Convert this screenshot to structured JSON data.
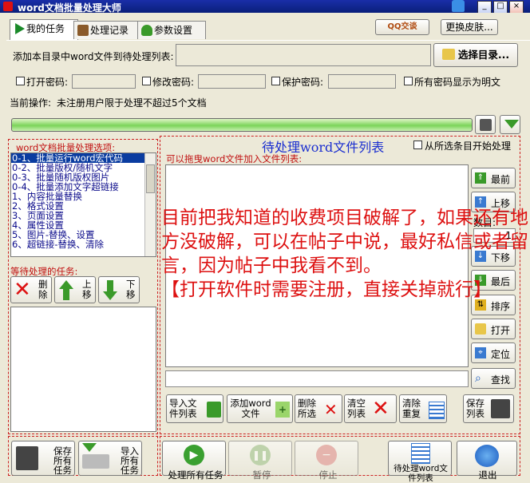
{
  "window": {
    "title": "word文档批量处理大师",
    "controls": [
      "_",
      "□",
      "×"
    ]
  },
  "tabs": [
    {
      "label": "我的任务"
    },
    {
      "label": "处理记录"
    },
    {
      "label": "参数设置"
    }
  ],
  "header": {
    "qq_label": "QQ交谈",
    "skin_button": "更换皮肤..."
  },
  "dir": {
    "label": "添加本目录中word文件到待处理列表:",
    "value": "",
    "select_button": "选择目录..."
  },
  "passwords": {
    "open_label": "打开密码:",
    "open_value": "",
    "modify_label": "修改密码:",
    "modify_value": "",
    "protect_label": "保护密码:",
    "protect_value": "",
    "show_plain_label": "所有密码显示为明文"
  },
  "status": {
    "label": "当前操作:",
    "text": "未注册用户限于处理不超过5个文档",
    "progress": 1.0
  },
  "options": {
    "title": "word文档批量处理选项:",
    "items": [
      "0-1、批量运行word宏代码",
      "0-2、批量版权/随机文字",
      "0-3、批量随机版权图片",
      "0-4、批量添加文字超链接",
      "1、内容批量替换",
      "2、格式设置",
      "3、页面设置",
      "4、属性设置",
      "5、图片-替换、设置",
      "6、超链接-替换、清除"
    ]
  },
  "tasks": {
    "title": "等待处理的任务:",
    "delete": "删除",
    "up": "上移",
    "down": "下移"
  },
  "filelist": {
    "title": "待处理word文件列表",
    "start_from_selected": "从所选条目开始处理",
    "drag_hint": "可以拖曳word文件加入文件列表:",
    "search_value": ""
  },
  "side_buttons": {
    "top": "最前",
    "up": "上移",
    "count_label": "数目:",
    "count_value": "1",
    "down": "下移",
    "bottom": "最后",
    "sort": "排序",
    "open": "打开",
    "locate": "定位",
    "find": "查找"
  },
  "bottom_buttons": {
    "import": "导入文件列表",
    "add": "添加word文件",
    "delete_sel": "删除所选",
    "clear": "清空列表",
    "clear_dup": "清除重复",
    "save_list": "保存列表"
  },
  "overlay": {
    "paragraph1": "目前把我知道的收费项目破解了，如果还有地方没破解，可以在帖子中说，最好私信或者留言，因为帖子中我看不到。",
    "paragraph2": "【打开软件时需要注册，直接关掉就行】"
  },
  "footer": {
    "save_tasks": "保存所有任务",
    "import_tasks": "导入所有任务",
    "process_all": "处理所有任务",
    "pause": "暂停",
    "stop": "停止",
    "file_list_btn": "待处理word文件列表",
    "exit": "退出"
  }
}
